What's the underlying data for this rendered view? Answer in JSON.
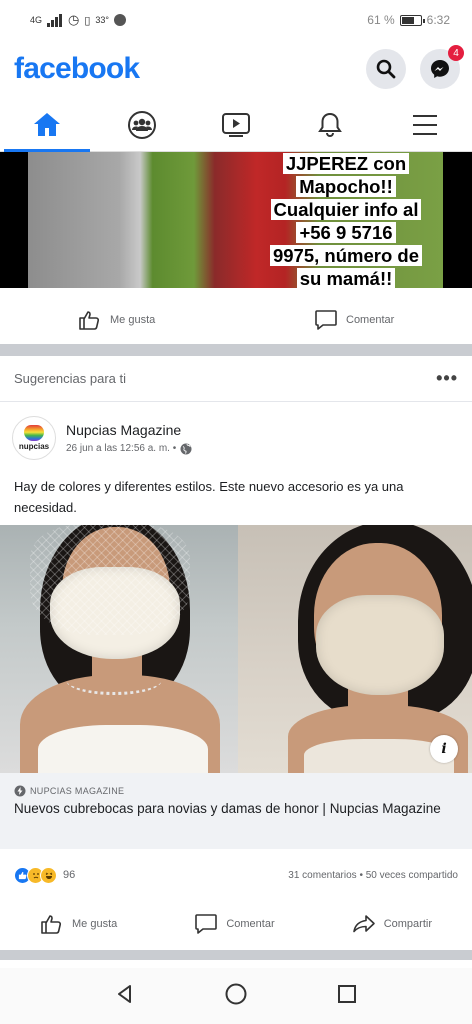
{
  "status_bar": {
    "network": "4G",
    "temperature": "33°",
    "battery": "61 %",
    "time": "6:32"
  },
  "app": {
    "logo": "facebook",
    "messenger_badge": "4"
  },
  "tabs": [
    {
      "name": "home",
      "icon": "home-icon",
      "active": true
    },
    {
      "name": "groups",
      "icon": "groups-icon",
      "active": false
    },
    {
      "name": "watch",
      "icon": "watch-icon",
      "active": false
    },
    {
      "name": "notifications",
      "icon": "bell-icon",
      "active": false
    },
    {
      "name": "menu",
      "icon": "hamburger-icon",
      "active": false
    }
  ],
  "previous_post": {
    "overlay_lines": [
      "JJPEREZ con",
      "Mapocho!!",
      "Cualquier info al",
      "+56 9 5716",
      "9975, número de",
      "su mamá!!"
    ],
    "like_label": "Me gusta",
    "comment_label": "Comentar"
  },
  "suggestions": {
    "title": "Sugerencias para ti",
    "more": "•••"
  },
  "post": {
    "page_name": "Nupcias Magazine",
    "avatar_text": "nupcias",
    "meta": "26 jun a las 12:56 a. m. •",
    "text": "Hay de colores y diferentes estilos. Este nuevo accesorio es ya una necesidad.",
    "link_domain": "NUPCIAS MAGAZINE",
    "link_title": "Nuevos cubrebocas para novias y damas de honor | Nupcias Magazine",
    "info_label": "i",
    "reaction_count": "96",
    "comments": "31 comentarios",
    "shares": "50 veces compartido",
    "like_label": "Me gusta",
    "comment_label": "Comentar",
    "share_label": "Compartir"
  }
}
